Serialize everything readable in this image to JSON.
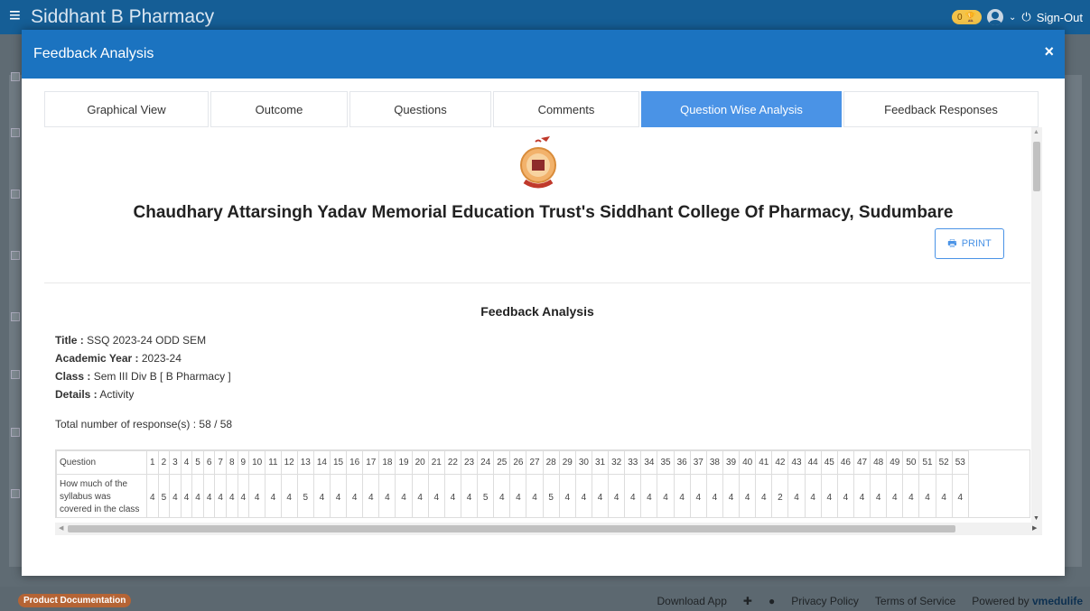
{
  "header": {
    "app_title": "Siddhant B Pharmacy",
    "notif_count": "0",
    "signout": "Sign-Out"
  },
  "modal": {
    "title": "Feedback Analysis",
    "close": "×"
  },
  "tabs": [
    {
      "label": "Graphical View"
    },
    {
      "label": "Outcome"
    },
    {
      "label": "Questions"
    },
    {
      "label": "Comments"
    },
    {
      "label": "Question Wise Analysis"
    },
    {
      "label": "Feedback Responses"
    }
  ],
  "report": {
    "college": "Chaudhary Attarsingh Yadav Memorial Education Trust's Siddhant College Of Pharmacy, Sudumbare",
    "print_label": "PRINT",
    "heading": "Feedback Analysis",
    "title_label": "Title :",
    "title_value": "SSQ 2023-24 ODD SEM",
    "year_label": "Academic Year :",
    "year_value": "2023-24",
    "class_label": "Class :",
    "class_value": "Sem III Div B [ B Pharmacy ]",
    "details_label": "Details :",
    "details_value": "Activity",
    "total": "Total number of response(s) : 58 / 58"
  },
  "table": {
    "question_header": "Question",
    "columns": [
      "1",
      "2",
      "3",
      "4",
      "5",
      "6",
      "7",
      "8",
      "9",
      "10",
      "11",
      "12",
      "13",
      "14",
      "15",
      "16",
      "17",
      "18",
      "19",
      "20",
      "21",
      "22",
      "23",
      "24",
      "25",
      "26",
      "27",
      "28",
      "29",
      "30",
      "31",
      "32",
      "33",
      "34",
      "35",
      "36",
      "37",
      "38",
      "39",
      "40",
      "41",
      "42",
      "43",
      "44",
      "45",
      "46",
      "47",
      "48",
      "49",
      "50",
      "51",
      "52",
      "53"
    ],
    "rows": [
      {
        "question": "How much of the syllabus was covered in the class",
        "values": [
          "4",
          "5",
          "4",
          "4",
          "4",
          "4",
          "4",
          "4",
          "4",
          "4",
          "4",
          "4",
          "5",
          "4",
          "4",
          "4",
          "4",
          "4",
          "4",
          "4",
          "4",
          "4",
          "4",
          "5",
          "4",
          "4",
          "4",
          "5",
          "4",
          "4",
          "4",
          "4",
          "4",
          "4",
          "4",
          "4",
          "4",
          "4",
          "4",
          "4",
          "4",
          "2",
          "4",
          "4",
          "4",
          "4",
          "4",
          "4",
          "4",
          "4",
          "4",
          "4",
          "4"
        ]
      }
    ]
  },
  "footer": {
    "product_doc": "Product Documentation",
    "download": "Download App",
    "privacy": "Privacy Policy",
    "terms": "Terms of Service",
    "powered": "Powered by",
    "brand": "vmedulife"
  }
}
